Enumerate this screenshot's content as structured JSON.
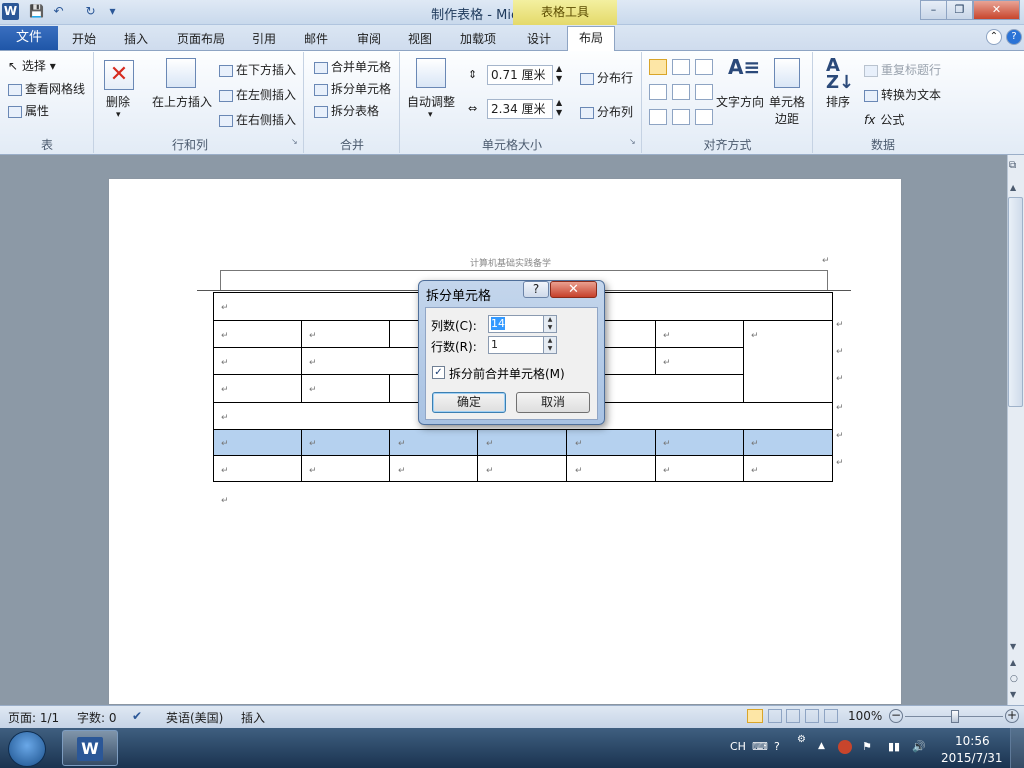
{
  "window": {
    "title": "制作表格 - Microsoft Word",
    "context_tab": "表格工具",
    "app_letter": "W",
    "minimize": "–",
    "restore": "❐",
    "close": "✕"
  },
  "tabs": {
    "file": "文件",
    "items": [
      "开始",
      "插入",
      "页面布局",
      "引用",
      "邮件",
      "审阅",
      "视图",
      "加载项",
      "设计",
      "布局"
    ],
    "help": "?",
    "collapse": "⌃"
  },
  "ribbon": {
    "table_group": {
      "label": "表",
      "select": "选择",
      "gridlines": "查看网格线",
      "properties": "属性"
    },
    "rowcol_group": {
      "label": "行和列",
      "delete": "删除",
      "insert_above": "在上方插入",
      "insert_below": "在下方插入",
      "insert_left": "在左侧插入",
      "insert_right": "在右侧插入"
    },
    "merge_group": {
      "label": "合并",
      "merge": "合并单元格",
      "split": "拆分单元格",
      "split_table": "拆分表格"
    },
    "cellsize_group": {
      "label": "单元格大小",
      "autofit": "自动调整",
      "height": "0.71 厘米",
      "width": "2.34 厘米",
      "dist_rows": "分布行",
      "dist_cols": "分布列"
    },
    "align_group": {
      "label": "对齐方式",
      "text_dir": "文字方向",
      "cell_margin_1": "单元格",
      "cell_margin_2": "边距"
    },
    "data_group": {
      "label": "数据",
      "sort": "排序",
      "repeat_header": "重复标题行",
      "convert": "转换为文本",
      "formula": "公式"
    }
  },
  "document": {
    "header_text": "计算机基础实践备学",
    "para_mark": "↵"
  },
  "dialog": {
    "title": "拆分单元格",
    "help": "?",
    "close": "✕",
    "cols_label": "列数(C):",
    "cols_value": "14",
    "rows_label": "行数(R):",
    "rows_value": "1",
    "merge_label": "拆分前合并单元格(M)",
    "merge_checked": true,
    "ok": "确定",
    "cancel": "取消"
  },
  "statusbar": {
    "page": "页面: 1/1",
    "words": "字数: 0",
    "language": "英语(美国)",
    "mode": "插入",
    "zoom": "100%"
  },
  "taskbar": {
    "ime": "CH",
    "time": "10:56",
    "date": "2015/7/31"
  }
}
